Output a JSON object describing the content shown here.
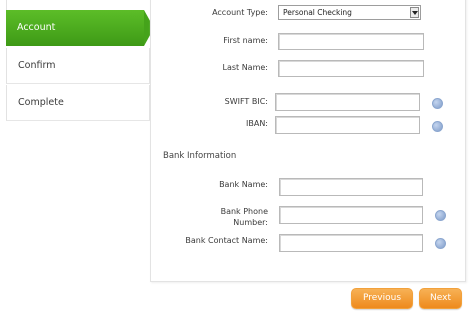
{
  "wizard_steps": [
    {
      "label": "Account",
      "active": true
    },
    {
      "label": "Confirm",
      "active": false
    },
    {
      "label": "Complete",
      "active": false
    }
  ],
  "form": {
    "account_type": {
      "label": "Account Type:",
      "value": "Personal Checking"
    },
    "first_name": {
      "label": "First name:",
      "value": ""
    },
    "last_name": {
      "label": "Last Name:",
      "value": ""
    },
    "swift_bic": {
      "label": "SWIFT BIC:",
      "value": ""
    },
    "iban": {
      "label": "IBAN:",
      "value": ""
    },
    "bank_section_title": "Bank Information",
    "bank_name": {
      "label": "Bank Name:",
      "value": ""
    },
    "bank_phone": {
      "label_line1": "Bank Phone",
      "label_line2": "Number:",
      "value": ""
    },
    "bank_contact": {
      "label": "Bank Contact Name:",
      "value": ""
    }
  },
  "buttons": {
    "previous": "Previous",
    "next": "Next"
  },
  "colors": {
    "active_step": "#45a31b",
    "button_orange": "#ee8a1c"
  },
  "icons": {
    "help": "help-icon"
  }
}
